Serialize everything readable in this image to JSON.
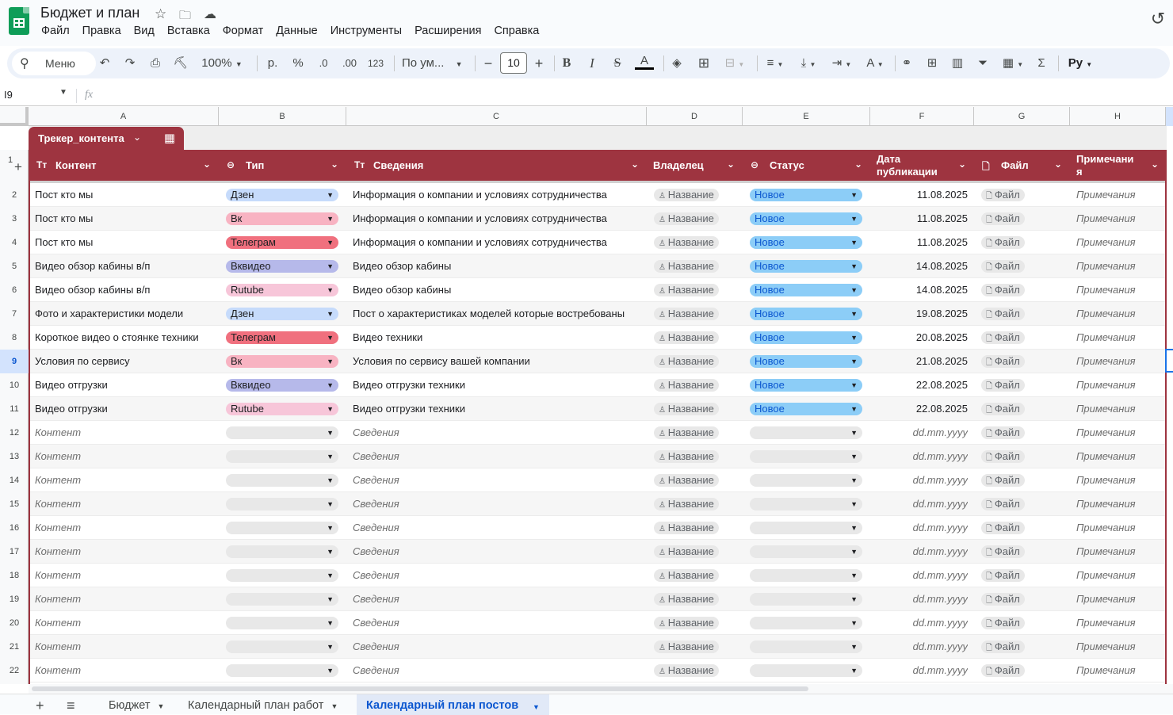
{
  "doc": {
    "title": "Бюджет и план",
    "menu": [
      "Файл",
      "Правка",
      "Вид",
      "Вставка",
      "Формат",
      "Данные",
      "Инструменты",
      "Расширения",
      "Справка"
    ]
  },
  "toolbar": {
    "search_label": "Меню",
    "zoom": "100%",
    "currency": "р.",
    "percent": "%",
    "dec_less": ".0",
    "dec_more": ".00",
    "num_format": "123",
    "font": "По ум...",
    "font_size": "10",
    "bold": "B",
    "italic": "I",
    "strike": "S",
    "text_color": "A",
    "input_tools": "Ру"
  },
  "formula_bar": {
    "cell_ref": "I9",
    "fx": "fx",
    "value": ""
  },
  "columns": [
    "A",
    "B",
    "C",
    "D",
    "E",
    "F",
    "G",
    "H"
  ],
  "table": {
    "name": "Трекер_контента",
    "headers": {
      "content": "Контент",
      "type": "Тип",
      "details": "Сведения",
      "owner": "Владелец",
      "status": "Статус",
      "date_l1": "Дата",
      "date_l2": "публикации",
      "file": "Файл",
      "notes_l1": "Примечани",
      "notes_l2": "я"
    },
    "row_numbers": [
      "1",
      "2",
      "3",
      "4",
      "5",
      "6",
      "7",
      "8",
      "9",
      "10",
      "11",
      "12",
      "13",
      "14",
      "15",
      "16",
      "17",
      "18",
      "19",
      "20",
      "21",
      "22"
    ],
    "selected_row": "9",
    "type_colors": {
      "Дзен": "#c6dbfb",
      "Вк": "#f8b3c2",
      "Телеграм": "#f0707e",
      "Вквидео": "#b6b9ea",
      "Rutube": "#f7c6d9",
      "": "#e8e8e8"
    },
    "status_color": "#8ccdf7",
    "placeholders": {
      "content": "Контент",
      "details": "Сведения",
      "owner": "Название",
      "date": "dd.mm.yyyy",
      "file": "Файл",
      "notes": "Примечания"
    },
    "rows": [
      {
        "content": "Пост кто мы",
        "type": "Дзен",
        "details": "Информация о компании и условиях сотрудничества",
        "owner": "Название",
        "status": "Новое",
        "date": "11.08.2025",
        "file": "Файл",
        "notes": "Примечания"
      },
      {
        "content": "Пост кто мы",
        "type": "Вк",
        "details": "Информация о компании и условиях сотрудничества",
        "owner": "Название",
        "status": "Новое",
        "date": "11.08.2025",
        "file": "Файл",
        "notes": "Примечания"
      },
      {
        "content": "Пост кто мы",
        "type": "Телеграм",
        "details": "Информация о компании и условиях сотрудничества",
        "owner": "Название",
        "status": "Новое",
        "date": "11.08.2025",
        "file": "Файл",
        "notes": "Примечания"
      },
      {
        "content": "Видео обзор кабины в/п",
        "type": "Вквидео",
        "details": "Видео обзор кабины",
        "owner": "Название",
        "status": "Новое",
        "date": "14.08.2025",
        "file": "Файл",
        "notes": "Примечания"
      },
      {
        "content": "Видео обзор кабины в/п",
        "type": "Rutube",
        "details": "Видео обзор кабины",
        "owner": "Название",
        "status": "Новое",
        "date": "14.08.2025",
        "file": "Файл",
        "notes": "Примечания"
      },
      {
        "content": "Фото и характеристики модели",
        "type": "Дзен",
        "details": "Пост о характеристиках моделей которые востребованы",
        "owner": "Название",
        "status": "Новое",
        "date": "19.08.2025",
        "file": "Файл",
        "notes": "Примечания"
      },
      {
        "content": "Короткое видео о стоянке техники",
        "type": "Телеграм",
        "details": "Видео техники",
        "owner": "Название",
        "status": "Новое",
        "date": "20.08.2025",
        "file": "Файл",
        "notes": "Примечания"
      },
      {
        "content": "Условия по сервису",
        "type": "Вк",
        "details": "Условия по сервису вашей компании",
        "owner": "Название",
        "status": "Новое",
        "date": "21.08.2025",
        "file": "Файл",
        "notes": "Примечания"
      },
      {
        "content": "Видео отгрузки",
        "type": "Вквидео",
        "details": "Видео отгрузки техники",
        "owner": "Название",
        "status": "Новое",
        "date": "22.08.2025",
        "file": "Файл",
        "notes": "Примечания"
      },
      {
        "content": "Видео отгрузки",
        "type": "Rutube",
        "details": "Видео отгрузки техники",
        "owner": "Название",
        "status": "Новое",
        "date": "22.08.2025",
        "file": "Файл",
        "notes": "Примечания"
      },
      {
        "content": "",
        "type": "",
        "details": "",
        "owner": "Название",
        "status": "",
        "date": "",
        "file": "Файл",
        "notes": "Примечания"
      },
      {
        "content": "",
        "type": "",
        "details": "",
        "owner": "Название",
        "status": "",
        "date": "",
        "file": "Файл",
        "notes": "Примечания"
      },
      {
        "content": "",
        "type": "",
        "details": "",
        "owner": "Название",
        "status": "",
        "date": "",
        "file": "Файл",
        "notes": "Примечания"
      },
      {
        "content": "",
        "type": "",
        "details": "",
        "owner": "Название",
        "status": "",
        "date": "",
        "file": "Файл",
        "notes": "Примечания"
      },
      {
        "content": "",
        "type": "",
        "details": "",
        "owner": "Название",
        "status": "",
        "date": "",
        "file": "Файл",
        "notes": "Примечания"
      },
      {
        "content": "",
        "type": "",
        "details": "",
        "owner": "Название",
        "status": "",
        "date": "",
        "file": "Файл",
        "notes": "Примечания"
      },
      {
        "content": "",
        "type": "",
        "details": "",
        "owner": "Название",
        "status": "",
        "date": "",
        "file": "Файл",
        "notes": "Примечания"
      },
      {
        "content": "",
        "type": "",
        "details": "",
        "owner": "Название",
        "status": "",
        "date": "",
        "file": "Файл",
        "notes": "Примечания"
      },
      {
        "content": "",
        "type": "",
        "details": "",
        "owner": "Название",
        "status": "",
        "date": "",
        "file": "Файл",
        "notes": "Примечания"
      },
      {
        "content": "",
        "type": "",
        "details": "",
        "owner": "Название",
        "status": "",
        "date": "",
        "file": "Файл",
        "notes": "Примечания"
      },
      {
        "content": "",
        "type": "",
        "details": "",
        "owner": "Название",
        "status": "",
        "date": "",
        "file": "Файл",
        "notes": "Примечания"
      }
    ]
  },
  "sheets": {
    "tabs": [
      "Бюджет",
      "Календарный план работ",
      "Календарный план постов"
    ],
    "active": "Календарный план постов"
  },
  "colors": {
    "header_bg": "#9e3440",
    "accent": "#0b57d0"
  }
}
